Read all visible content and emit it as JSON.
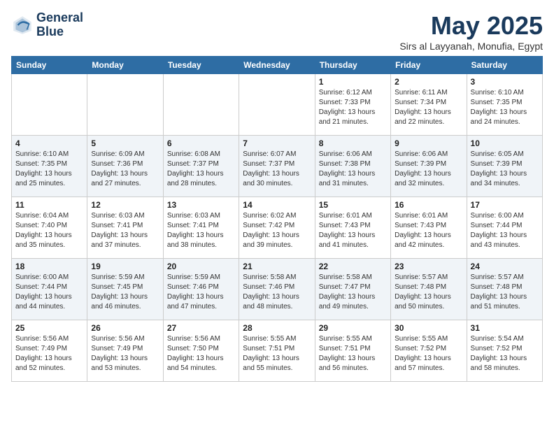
{
  "logo": {
    "line1": "General",
    "line2": "Blue"
  },
  "title": "May 2025",
  "subtitle": "Sirs al Layyanah, Monufia, Egypt",
  "days_of_week": [
    "Sunday",
    "Monday",
    "Tuesday",
    "Wednesday",
    "Thursday",
    "Friday",
    "Saturday"
  ],
  "weeks": [
    [
      {
        "day": "",
        "info": ""
      },
      {
        "day": "",
        "info": ""
      },
      {
        "day": "",
        "info": ""
      },
      {
        "day": "",
        "info": ""
      },
      {
        "day": "1",
        "info": "Sunrise: 6:12 AM\nSunset: 7:33 PM\nDaylight: 13 hours\nand 21 minutes."
      },
      {
        "day": "2",
        "info": "Sunrise: 6:11 AM\nSunset: 7:34 PM\nDaylight: 13 hours\nand 22 minutes."
      },
      {
        "day": "3",
        "info": "Sunrise: 6:10 AM\nSunset: 7:35 PM\nDaylight: 13 hours\nand 24 minutes."
      }
    ],
    [
      {
        "day": "4",
        "info": "Sunrise: 6:10 AM\nSunset: 7:35 PM\nDaylight: 13 hours\nand 25 minutes."
      },
      {
        "day": "5",
        "info": "Sunrise: 6:09 AM\nSunset: 7:36 PM\nDaylight: 13 hours\nand 27 minutes."
      },
      {
        "day": "6",
        "info": "Sunrise: 6:08 AM\nSunset: 7:37 PM\nDaylight: 13 hours\nand 28 minutes."
      },
      {
        "day": "7",
        "info": "Sunrise: 6:07 AM\nSunset: 7:37 PM\nDaylight: 13 hours\nand 30 minutes."
      },
      {
        "day": "8",
        "info": "Sunrise: 6:06 AM\nSunset: 7:38 PM\nDaylight: 13 hours\nand 31 minutes."
      },
      {
        "day": "9",
        "info": "Sunrise: 6:06 AM\nSunset: 7:39 PM\nDaylight: 13 hours\nand 32 minutes."
      },
      {
        "day": "10",
        "info": "Sunrise: 6:05 AM\nSunset: 7:39 PM\nDaylight: 13 hours\nand 34 minutes."
      }
    ],
    [
      {
        "day": "11",
        "info": "Sunrise: 6:04 AM\nSunset: 7:40 PM\nDaylight: 13 hours\nand 35 minutes."
      },
      {
        "day": "12",
        "info": "Sunrise: 6:03 AM\nSunset: 7:41 PM\nDaylight: 13 hours\nand 37 minutes."
      },
      {
        "day": "13",
        "info": "Sunrise: 6:03 AM\nSunset: 7:41 PM\nDaylight: 13 hours\nand 38 minutes."
      },
      {
        "day": "14",
        "info": "Sunrise: 6:02 AM\nSunset: 7:42 PM\nDaylight: 13 hours\nand 39 minutes."
      },
      {
        "day": "15",
        "info": "Sunrise: 6:01 AM\nSunset: 7:43 PM\nDaylight: 13 hours\nand 41 minutes."
      },
      {
        "day": "16",
        "info": "Sunrise: 6:01 AM\nSunset: 7:43 PM\nDaylight: 13 hours\nand 42 minutes."
      },
      {
        "day": "17",
        "info": "Sunrise: 6:00 AM\nSunset: 7:44 PM\nDaylight: 13 hours\nand 43 minutes."
      }
    ],
    [
      {
        "day": "18",
        "info": "Sunrise: 6:00 AM\nSunset: 7:44 PM\nDaylight: 13 hours\nand 44 minutes."
      },
      {
        "day": "19",
        "info": "Sunrise: 5:59 AM\nSunset: 7:45 PM\nDaylight: 13 hours\nand 46 minutes."
      },
      {
        "day": "20",
        "info": "Sunrise: 5:59 AM\nSunset: 7:46 PM\nDaylight: 13 hours\nand 47 minutes."
      },
      {
        "day": "21",
        "info": "Sunrise: 5:58 AM\nSunset: 7:46 PM\nDaylight: 13 hours\nand 48 minutes."
      },
      {
        "day": "22",
        "info": "Sunrise: 5:58 AM\nSunset: 7:47 PM\nDaylight: 13 hours\nand 49 minutes."
      },
      {
        "day": "23",
        "info": "Sunrise: 5:57 AM\nSunset: 7:48 PM\nDaylight: 13 hours\nand 50 minutes."
      },
      {
        "day": "24",
        "info": "Sunrise: 5:57 AM\nSunset: 7:48 PM\nDaylight: 13 hours\nand 51 minutes."
      }
    ],
    [
      {
        "day": "25",
        "info": "Sunrise: 5:56 AM\nSunset: 7:49 PM\nDaylight: 13 hours\nand 52 minutes."
      },
      {
        "day": "26",
        "info": "Sunrise: 5:56 AM\nSunset: 7:49 PM\nDaylight: 13 hours\nand 53 minutes."
      },
      {
        "day": "27",
        "info": "Sunrise: 5:56 AM\nSunset: 7:50 PM\nDaylight: 13 hours\nand 54 minutes."
      },
      {
        "day": "28",
        "info": "Sunrise: 5:55 AM\nSunset: 7:51 PM\nDaylight: 13 hours\nand 55 minutes."
      },
      {
        "day": "29",
        "info": "Sunrise: 5:55 AM\nSunset: 7:51 PM\nDaylight: 13 hours\nand 56 minutes."
      },
      {
        "day": "30",
        "info": "Sunrise: 5:55 AM\nSunset: 7:52 PM\nDaylight: 13 hours\nand 57 minutes."
      },
      {
        "day": "31",
        "info": "Sunrise: 5:54 AM\nSunset: 7:52 PM\nDaylight: 13 hours\nand 58 minutes."
      }
    ]
  ]
}
